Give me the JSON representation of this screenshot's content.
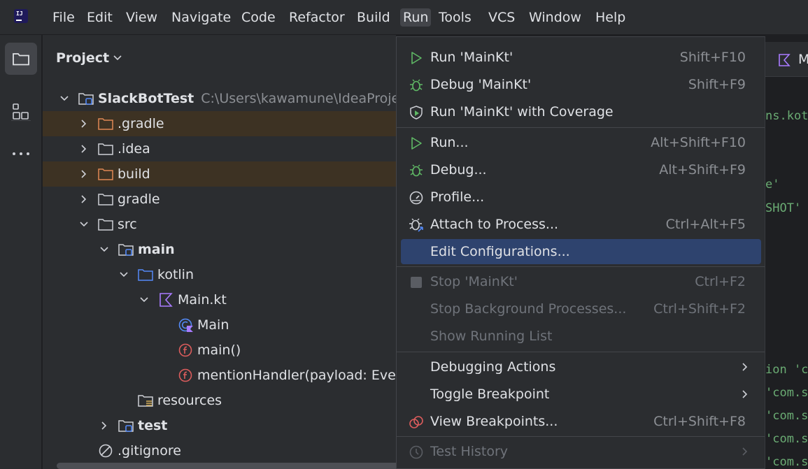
{
  "menubar": {
    "items": [
      {
        "label": "File",
        "mnemonic": "F"
      },
      {
        "label": "Edit",
        "mnemonic": "E"
      },
      {
        "label": "View",
        "mnemonic": "V"
      },
      {
        "label": "Navigate",
        "mnemonic": "N"
      },
      {
        "label": "Code",
        "mnemonic": "C"
      },
      {
        "label": "Refactor",
        "mnemonic": "R"
      },
      {
        "label": "Build",
        "mnemonic": "B"
      },
      {
        "label": "Run",
        "mnemonic": "u",
        "active": true
      },
      {
        "label": "Tools",
        "mnemonic": "T"
      },
      {
        "label": "VCS",
        "mnemonic": "S"
      },
      {
        "label": "Window",
        "mnemonic": "W"
      },
      {
        "label": "Help",
        "mnemonic": "H"
      }
    ]
  },
  "logo": {
    "text": "IJ"
  },
  "project_panel": {
    "title": "Project",
    "tree": [
      {
        "label": "SlackBotTest",
        "path": "C:\\Users\\kawamune\\IdeaProjects\\SlackBotTest",
        "icon": "module-folder-icon",
        "expanded": true,
        "bold": true
      },
      {
        "label": ".gradle",
        "icon": "excluded-folder-icon",
        "expanded": false
      },
      {
        "label": ".idea",
        "icon": "folder-icon",
        "expanded": false
      },
      {
        "label": "build",
        "icon": "excluded-folder-icon",
        "expanded": false
      },
      {
        "label": "gradle",
        "icon": "folder-icon",
        "expanded": false
      },
      {
        "label": "src",
        "icon": "folder-icon",
        "expanded": true
      },
      {
        "label": "main",
        "icon": "module-folder-icon",
        "expanded": true,
        "bold": true
      },
      {
        "label": "kotlin",
        "icon": "source-folder-icon",
        "expanded": true
      },
      {
        "label": "Main.kt",
        "icon": "kotlin-file-icon",
        "expanded": true
      },
      {
        "label": "Main",
        "icon": "kotlin-class-icon"
      },
      {
        "label": "main()",
        "icon": "function-icon"
      },
      {
        "label": "mentionHandler(payload: EventsApiPayload<AppMentionEvent>)",
        "icon": "function-icon"
      },
      {
        "label": "resources",
        "icon": "resources-folder-icon"
      },
      {
        "label": "test",
        "icon": "module-folder-icon",
        "expanded": false,
        "bold": true
      },
      {
        "label": ".gitignore",
        "icon": "ignored-file-icon"
      }
    ]
  },
  "editor": {
    "tab_label": "M",
    "code_fragments": [
      "ns.kot",
      "e'",
      "SHOT'",
      "ion 'c",
      "'com.s",
      "'com.s",
      "'com.s",
      "'com.s"
    ]
  },
  "run_menu": {
    "items": [
      {
        "label": "Run 'MainKt'",
        "shortcut": "Shift+F10",
        "icon": "run-icon"
      },
      {
        "label": "Debug 'MainKt'",
        "shortcut": "Shift+F9",
        "icon": "debug-icon"
      },
      {
        "label": "Run 'MainKt' with Coverage",
        "shortcut": "",
        "icon": "coverage-icon"
      },
      {
        "label": "Run...",
        "shortcut": "Alt+Shift+F10",
        "icon": "run-icon"
      },
      {
        "label": "Debug...",
        "shortcut": "Alt+Shift+F9",
        "icon": "debug-icon"
      },
      {
        "label": "Profile...",
        "shortcut": "",
        "icon": "profile-icon"
      },
      {
        "label": "Attach to Process...",
        "shortcut": "Ctrl+Alt+F5",
        "icon": "attach-icon"
      },
      {
        "label": "Edit Configurations...",
        "shortcut": "",
        "icon": "",
        "selected": true
      },
      {
        "label": "Stop 'MainKt'",
        "shortcut": "Ctrl+F2",
        "icon": "stop-icon",
        "disabled": true
      },
      {
        "label": "Stop Background Processes...",
        "shortcut": "Ctrl+Shift+F2",
        "icon": "",
        "disabled": true
      },
      {
        "label": "Show Running List",
        "shortcut": "",
        "icon": "",
        "disabled": true
      },
      {
        "label": "Debugging Actions",
        "shortcut": "",
        "icon": "",
        "submenu": true
      },
      {
        "label": "Toggle Breakpoint",
        "shortcut": "",
        "icon": "",
        "submenu": true
      },
      {
        "label": "View Breakpoints...",
        "shortcut": "Ctrl+Shift+F8",
        "icon": "breakpoints-icon"
      },
      {
        "label": "Test History",
        "shortcut": "",
        "icon": "history-icon",
        "disabled": true,
        "submenu": true
      }
    ]
  },
  "colors": {
    "accent": "#2e436e",
    "excluded_highlight": "#3d3223",
    "run_green": "#5fb865",
    "kotlin_purple": "#a97bff",
    "function_red": "#db5c5c",
    "excluded_orange": "#e08855"
  }
}
